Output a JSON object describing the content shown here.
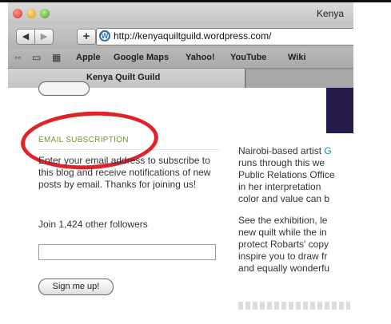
{
  "window": {
    "title": "Kenya"
  },
  "toolbar": {
    "back_label": "◀",
    "forward_label": "▶",
    "add_label": "+",
    "url": "http://kenyaquiltguild.wordpress.com/",
    "wp_logo_letter": "W"
  },
  "bookmarks": {
    "items": [
      "Apple",
      "Google Maps",
      "Yahoo!",
      "YouTube",
      "Wiki"
    ],
    "icons": [
      "reading-glasses-icon",
      "book-icon",
      "grid-icon"
    ]
  },
  "tabs": [
    {
      "label": "Kenya Quilt Guild",
      "active": true
    }
  ],
  "sidebar": {
    "email_heading": "EMAIL SUBSCRIPTION",
    "blurb": "Enter your email address to subscribe to this blog and receive notifications of new posts by email. Thanks for joining us!",
    "followers": "Join 1,424 other followers",
    "email_value": "",
    "signup_label": "Sign me up!"
  },
  "article": {
    "p1": {
      "line1_prefix": "Nairobi-based artist ",
      "line1_link": "G",
      "line2": "runs through this we",
      "line3": "Public Relations Office",
      "line4": "in her interpretation",
      "line5": "color and value can b"
    },
    "p2": {
      "line1": "See the exhibition, le",
      "line2": "new quilt while the in",
      "line3": "protect Robarts' copy",
      "line4": "inspire you to draw fr",
      "line5": "and equally wonderfu"
    }
  },
  "colors": {
    "email_heading": "#6c9a2c",
    "annotation_circle": "#e0232b",
    "link": "#1a8bb5"
  }
}
